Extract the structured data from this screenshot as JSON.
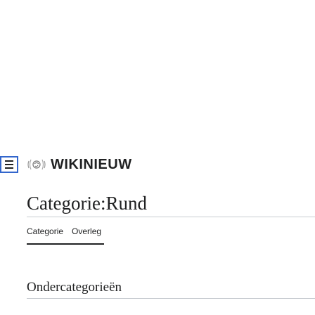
{
  "header": {
    "menu_icon": "hamburger-menu-icon",
    "logo_icon": "wikinews-globe-icon",
    "wordmark": "WIKINIEUW"
  },
  "page": {
    "title": "Categorie:Rund",
    "tabs": [
      {
        "label": "Categorie"
      },
      {
        "label": "Overleg"
      }
    ],
    "section_heading": "Ondercategorieën"
  },
  "colors": {
    "menu_border": "#3366cc",
    "text": "#202122",
    "rule": "#c8ccd1"
  }
}
